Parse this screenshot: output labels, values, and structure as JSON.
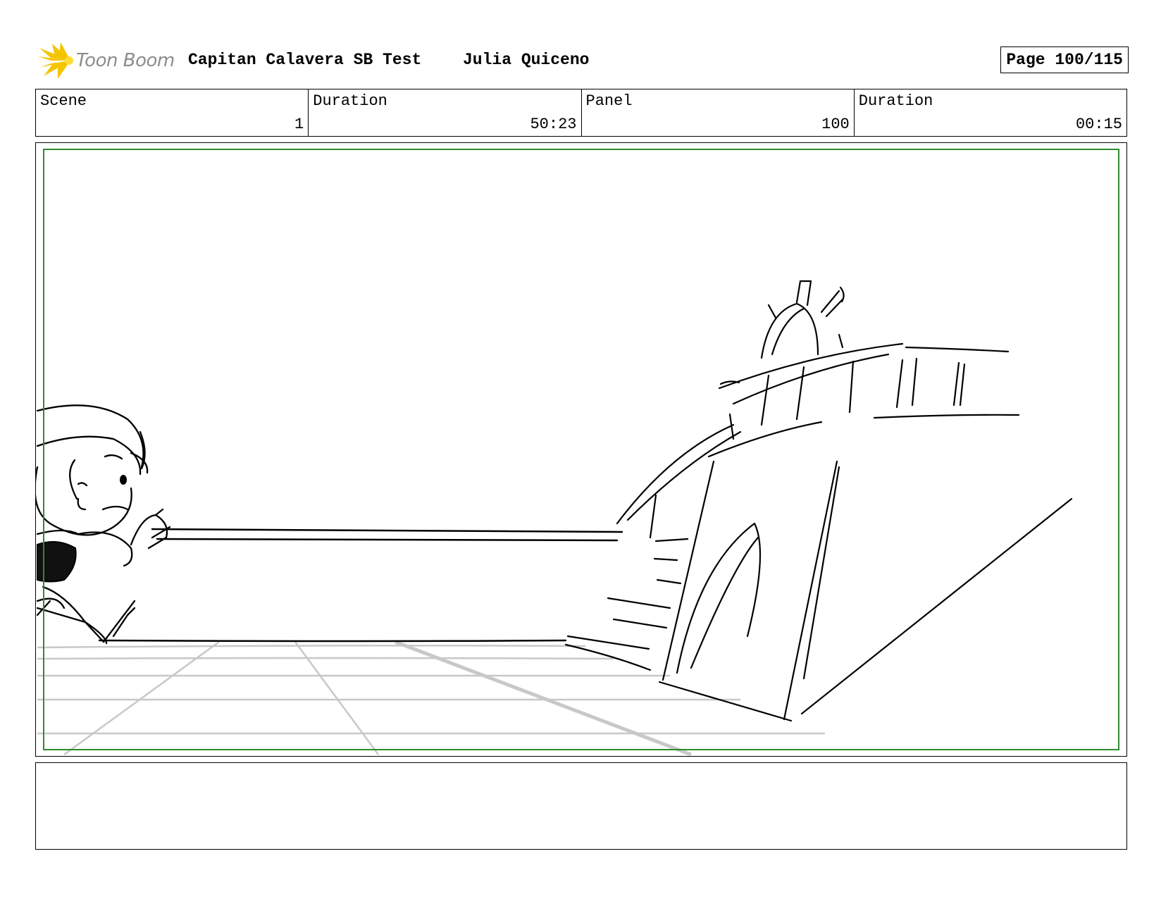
{
  "header": {
    "logo_text": "Toon Boom",
    "project_title": "Capitan Calavera SB Test",
    "author": "Julia Quiceno",
    "page_label": "Page 100/115"
  },
  "info": {
    "scene_label": "Scene",
    "scene_value": "1",
    "scene_duration_label": "Duration",
    "scene_duration_value": "50:23",
    "panel_label": "Panel",
    "panel_value": "100",
    "panel_duration_label": "Duration",
    "panel_duration_value": "00:15"
  },
  "colors": {
    "safe_frame": "#2e8b2e",
    "logo_yellow": "#f5c400",
    "logo_text": "#8c8c8c",
    "sketch_line": "#000000",
    "floor_grid": "#c8c8c8"
  },
  "notes": {
    "text": ""
  }
}
